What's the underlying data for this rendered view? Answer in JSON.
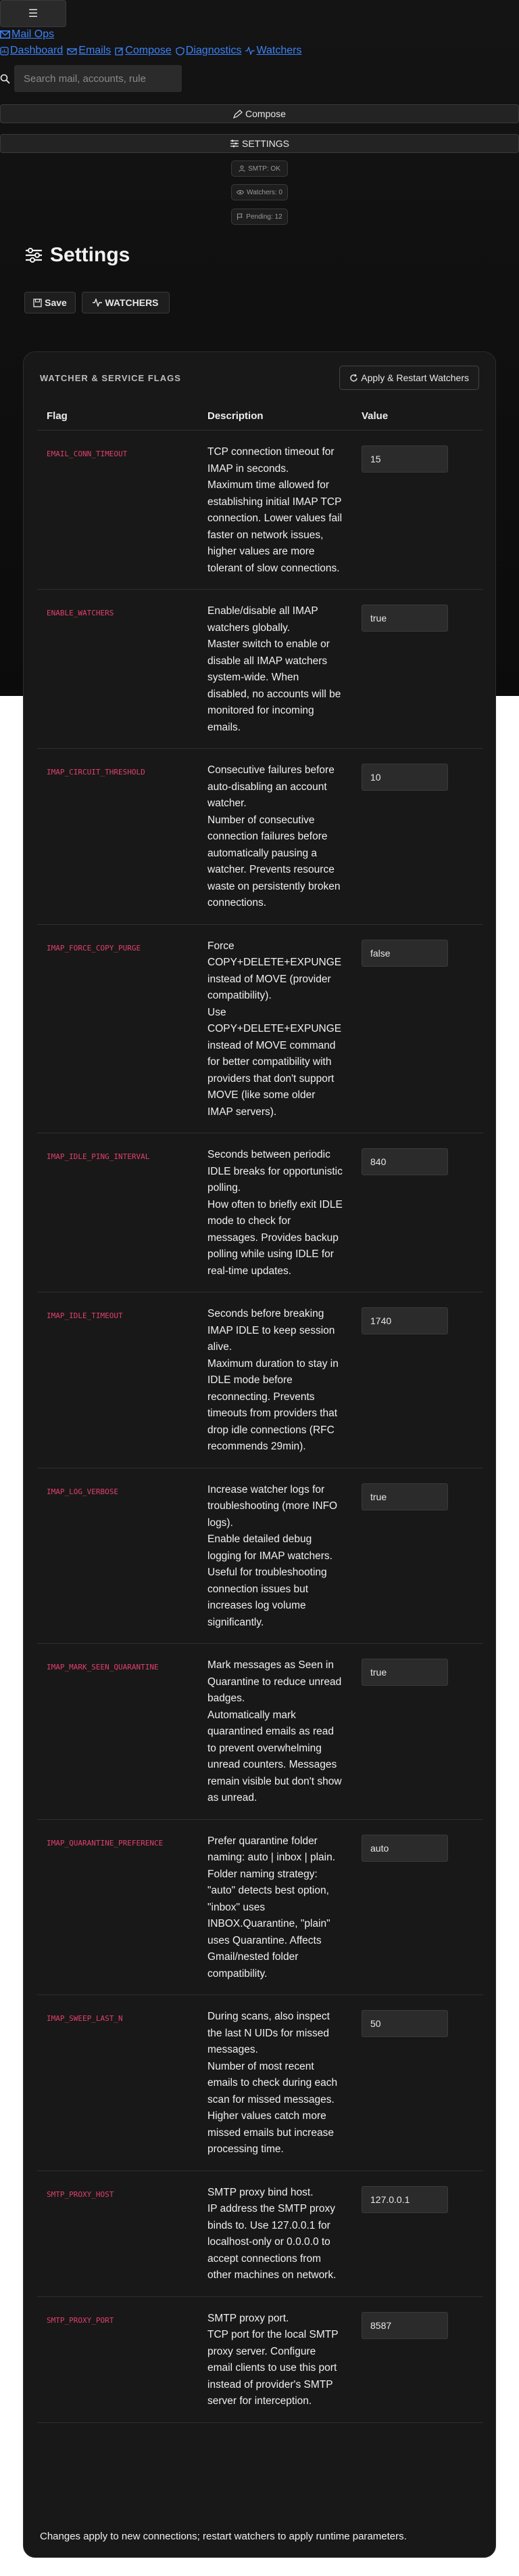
{
  "topbar": {
    "menu_icon": "☰",
    "brand_label": "Mail Ops",
    "search_placeholder": "Search mail, accounts, rule"
  },
  "nav": [
    {
      "icon": "dashboard-icon",
      "label": "Dashboard"
    },
    {
      "icon": "emails-icon",
      "label": "Emails"
    },
    {
      "icon": "compose-icon",
      "label": "Compose"
    },
    {
      "icon": "diagnostics-icon",
      "label": "Diagnostics"
    },
    {
      "icon": "watchers-icon",
      "label": "Watchers"
    }
  ],
  "bars": {
    "compose_label": "Compose",
    "settings_label": "SETTINGS"
  },
  "status": {
    "smtp": "SMTP: OK",
    "watchers": "Watchers: 0",
    "pending": "Pending: 12"
  },
  "page": {
    "title": "Settings",
    "save_label": "Save",
    "watchers_label": "WATCHERS"
  },
  "card": {
    "title": "WATCHER & SERVICE FLAGS",
    "apply_label": "Apply & Restart Watchers",
    "columns": [
      "Flag",
      "Description",
      "Value"
    ],
    "footer": "Changes apply to new connections; restart watchers to apply runtime parameters."
  },
  "flags": [
    {
      "name": "EMAIL_CONN_TIMEOUT",
      "summary": "TCP connection timeout for IMAP in seconds.",
      "detail": "Maximum time allowed for establishing initial IMAP TCP connection. Lower values fail faster on network issues, higher values are more tolerant of slow connections.",
      "value": "15"
    },
    {
      "name": "ENABLE_WATCHERS",
      "summary": "Enable/disable all IMAP watchers globally.",
      "detail": "Master switch to enable or disable all IMAP watchers system-wide. When disabled, no accounts will be monitored for incoming emails.",
      "value": "true"
    },
    {
      "name": "IMAP_CIRCUIT_THRESHOLD",
      "summary": "Consecutive failures before auto-disabling an account watcher.",
      "detail": "Number of consecutive connection failures before automatically pausing a watcher. Prevents resource waste on persistently broken connections.",
      "value": "10"
    },
    {
      "name": "IMAP_FORCE_COPY_PURGE",
      "summary": "Force COPY+DELETE+EXPUNGE instead of MOVE (provider compatibility).",
      "detail": "Use COPY+DELETE+EXPUNGE instead of MOVE command for better compatibility with providers that don't support MOVE (like some older IMAP servers).",
      "value": "false"
    },
    {
      "name": "IMAP_IDLE_PING_INTERVAL",
      "summary": "Seconds between periodic IDLE breaks for opportunistic polling.",
      "detail": "How often to briefly exit IDLE mode to check for messages. Provides backup polling while using IDLE for real-time updates.",
      "value": "840"
    },
    {
      "name": "IMAP_IDLE_TIMEOUT",
      "summary": "Seconds before breaking IMAP IDLE to keep session alive.",
      "detail": "Maximum duration to stay in IDLE mode before reconnecting. Prevents timeouts from providers that drop idle connections (RFC recommends 29min).",
      "value": "1740"
    },
    {
      "name": "IMAP_LOG_VERBOSE",
      "summary": "Increase watcher logs for troubleshooting (more INFO logs).",
      "detail": "Enable detailed debug logging for IMAP watchers. Useful for troubleshooting connection issues but increases log volume significantly.",
      "value": "true"
    },
    {
      "name": "IMAP_MARK_SEEN_QUARANTINE",
      "summary": "Mark messages as Seen in Quarantine to reduce unread badges.",
      "detail": "Automatically mark quarantined emails as read to prevent overwhelming unread counters. Messages remain visible but don't show as unread.",
      "value": "true"
    },
    {
      "name": "IMAP_QUARANTINE_PREFERENCE",
      "summary": "Prefer quarantine folder naming: auto | inbox | plain.",
      "detail": "Folder naming strategy: \"auto\" detects best option, \"inbox\" uses INBOX.Quarantine, \"plain\" uses Quarantine. Affects Gmail/nested folder compatibility.",
      "value": "auto"
    },
    {
      "name": "IMAP_SWEEP_LAST_N",
      "summary": "During scans, also inspect the last N UIDs for missed messages.",
      "detail": "Number of most recent emails to check during each scan for missed messages. Higher values catch more missed emails but increase processing time.",
      "value": "50"
    },
    {
      "name": "SMTP_PROXY_HOST",
      "summary": "SMTP proxy bind host.",
      "detail": "IP address the SMTP proxy binds to. Use 127.0.0.1 for localhost-only or 0.0.0.0 to accept connections from other machines on network.",
      "value": "127.0.0.1"
    },
    {
      "name": "SMTP_PROXY_PORT",
      "summary": "SMTP proxy port.",
      "detail": "TCP port for the local SMTP proxy server. Configure email clients to use this port instead of provider's SMTP server for interception.",
      "value": "8587"
    }
  ]
}
